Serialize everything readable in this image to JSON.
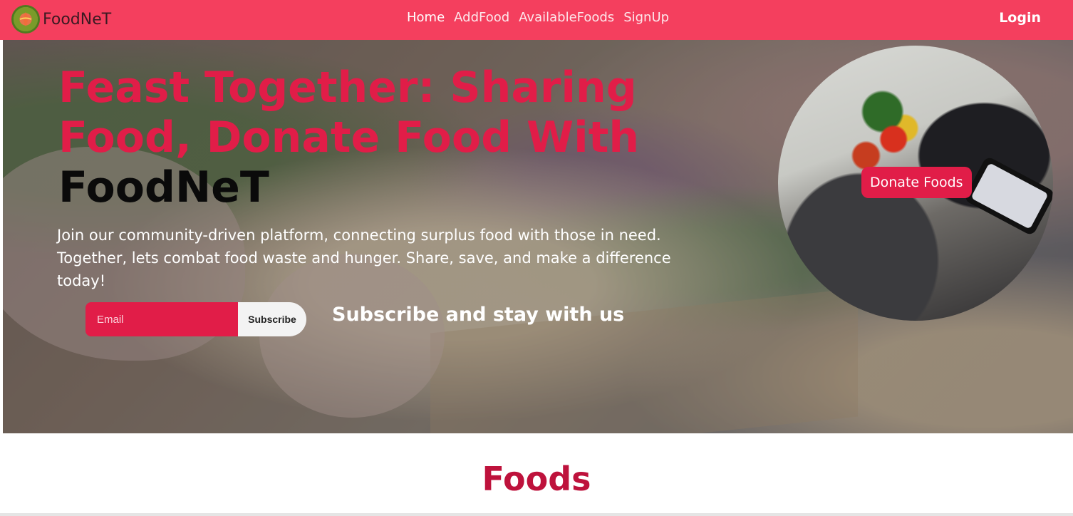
{
  "navbar": {
    "brand": "FoodNeT",
    "links": [
      "Home",
      "AddFood",
      "AvailableFoods",
      "SignUp"
    ],
    "login": "Login",
    "colors": {
      "background": "#f43f5e",
      "text": "#ffffff"
    },
    "logo_icon": "food-logo-icon"
  },
  "hero": {
    "headline_pink": "Feast Together: Sharing Food, Donate Food With",
    "headline_dark": "FoodNeT",
    "tagline": "Join our community-driven platform, connecting surplus food with those in need. Together, lets combat food waste and hunger. Share, save, and make a difference today!",
    "email_placeholder": "Email",
    "subscribe_button": "Subscribe",
    "subscribe_text": "Subscribe and stay with us",
    "donate_button": "Donate Foods",
    "colors": {
      "accent": "#e11d48",
      "headline_dark": "#0a0a0a"
    }
  },
  "foods_section": {
    "title": "Foods",
    "title_color": "#be123c"
  }
}
